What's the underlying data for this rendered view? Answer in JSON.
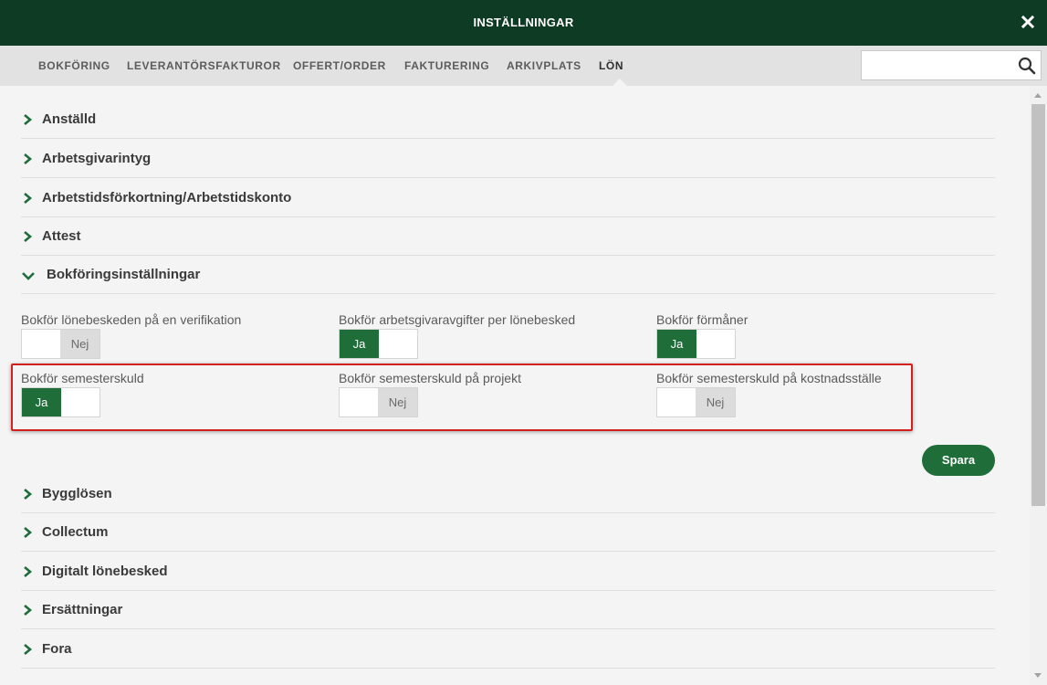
{
  "window": {
    "title": "INSTÄLLNINGAR"
  },
  "tabs": [
    {
      "label": "BOKFÖRING",
      "active": false
    },
    {
      "label": "LEVERANTÖRSFAKTUROR",
      "active": false
    },
    {
      "label": "OFFERT/ORDER",
      "active": false
    },
    {
      "label": "FAKTURERING",
      "active": false
    },
    {
      "label": "ARKIVPLATS",
      "active": false
    },
    {
      "label": "LÖN",
      "active": true
    }
  ],
  "search": {
    "value": "",
    "placeholder": ""
  },
  "sections_before": [
    {
      "label": "Anställd",
      "expanded": false
    },
    {
      "label": "Arbetsgivarintyg",
      "expanded": false
    },
    {
      "label": "Arbetstidsförkortning/Arbetstidskonto",
      "expanded": false
    },
    {
      "label": "Attest",
      "expanded": false
    }
  ],
  "open_section": {
    "label": "Bokföringsinställningar",
    "expanded": true,
    "settings": [
      {
        "label": "Bokför lönebeskeden på en verifikation",
        "value": "Nej",
        "on_label": "",
        "off_label": "Nej"
      },
      {
        "label": "Bokför arbetsgivaravgifter per lönebesked",
        "value": "Ja",
        "on_label": "Ja",
        "off_label": ""
      },
      {
        "label": "Bokför förmåner",
        "value": "Ja",
        "on_label": "Ja",
        "off_label": ""
      },
      {
        "label": "Bokför semesterskuld",
        "value": "Ja",
        "on_label": "Ja",
        "off_label": ""
      },
      {
        "label": "Bokför semesterskuld på projekt",
        "value": "Nej",
        "on_label": "",
        "off_label": "Nej"
      },
      {
        "label": "Bokför semesterskuld på kostnadsställe",
        "value": "Nej",
        "on_label": "",
        "off_label": "Nej"
      }
    ],
    "save_label": "Spara"
  },
  "sections_after": [
    {
      "label": "Bygglösen",
      "expanded": false
    },
    {
      "label": "Collectum",
      "expanded": false
    },
    {
      "label": "Digitalt lönebesked",
      "expanded": false
    },
    {
      "label": "Ersättningar",
      "expanded": false
    },
    {
      "label": "Fora",
      "expanded": false
    }
  ],
  "colors": {
    "header_bg": "#0d3b24",
    "accent_green": "#1f6e3a",
    "highlight_red": "#d41f1f",
    "toggle_off_bg": "#dcdcdc"
  },
  "icons": {
    "close": "close-icon",
    "search": "search-icon",
    "chevron_right": "chevron-right-icon",
    "chevron_down": "chevron-down-icon"
  }
}
